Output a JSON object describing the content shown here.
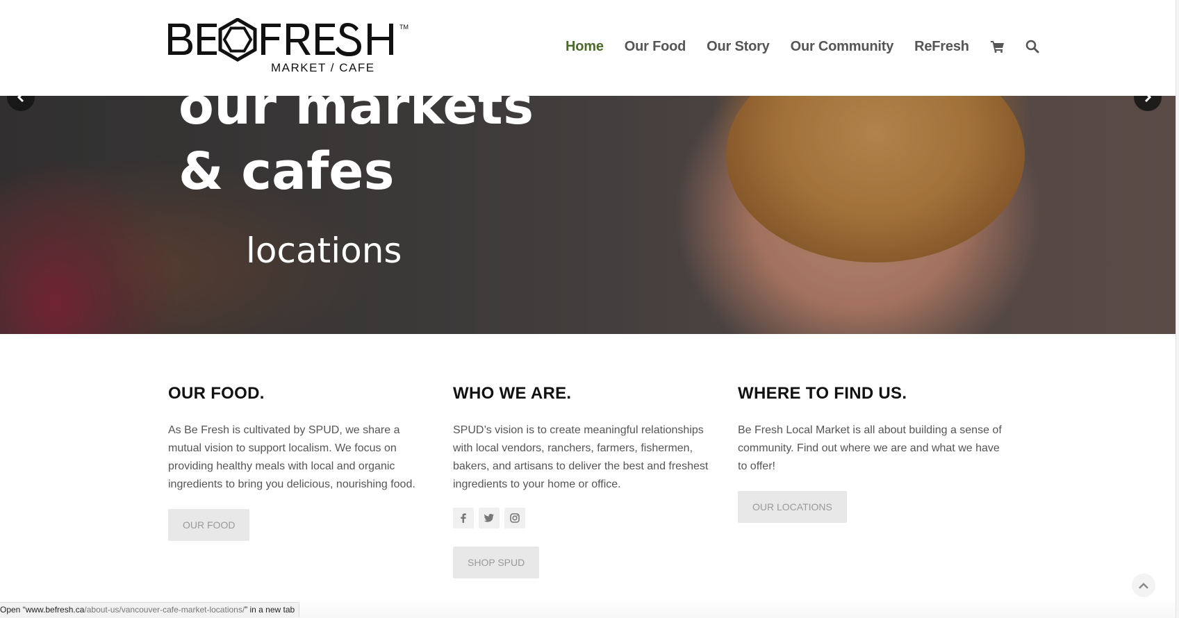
{
  "header": {
    "logo": {
      "brand": "BE FRESH",
      "trademark": "TM",
      "subtitle": "MARKET / CAFE"
    },
    "nav": [
      {
        "label": "Home",
        "active": true
      },
      {
        "label": "Our Food",
        "active": false
      },
      {
        "label": "Our Story",
        "active": false
      },
      {
        "label": "Our Community",
        "active": false
      },
      {
        "label": "ReFresh",
        "active": false
      }
    ],
    "icons": [
      "cart-icon",
      "search-icon"
    ]
  },
  "hero": {
    "line1": "our markets",
    "line2": "& cafes",
    "line3": "locations",
    "prev_icon": "chevron-left-icon",
    "next_icon": "chevron-right-icon"
  },
  "columns": [
    {
      "heading": "OUR FOOD.",
      "body": "As Be Fresh is cultivated by SPUD, we share a mutual vision to support localism. We focus on providing healthy meals with local and organic ingredients to bring you delicious, nourishing food.",
      "button": "OUR FOOD"
    },
    {
      "heading": "WHO WE ARE.",
      "body": "SPUD’s vision is to create meaningful relationships with local vendors, ranchers, farmers, fishermen, bakers, and artisans to deliver the best and freshest ingredients to your home or office.",
      "socials": [
        "facebook-icon",
        "twitter-icon",
        "instagram-icon"
      ],
      "button": "SHOP SPUD"
    },
    {
      "heading": "WHERE TO FIND US.",
      "body": "Be Fresh Local Market is all about building a sense of community. Find out where we are and what we have to offer!",
      "button": "OUR LOCATIONS"
    }
  ],
  "status_bar": {
    "prefix": "Open “",
    "domain": "www.befresh.ca",
    "path": "/about-us/vancouver-cafe-market-locations/",
    "suffix": "” in a new tab"
  },
  "colors": {
    "nav_active": "#4c6b2a",
    "nav_text": "#555555",
    "heading": "#111111",
    "body_text": "#555555",
    "button_bg": "#e8e8e8",
    "button_text": "#999999"
  }
}
